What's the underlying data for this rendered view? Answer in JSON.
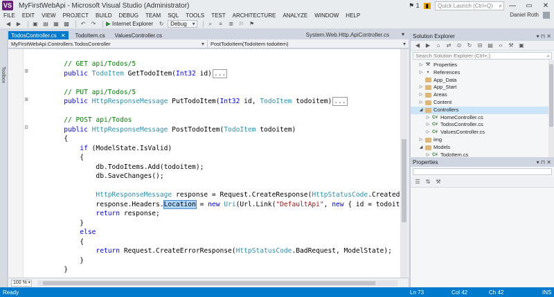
{
  "window": {
    "title": "MyFirstWebApi - Microsoft Visual Studio (Administrator)",
    "logo": "VS",
    "flag_count": "1",
    "notifications": "",
    "quick_launch_placeholder": "Quick Launch (Ctrl+Q)",
    "controls": {
      "minimize": "—",
      "maximize": "▭",
      "close": "✕"
    }
  },
  "menu": {
    "items": [
      "FILE",
      "EDIT",
      "VIEW",
      "PROJECT",
      "BUILD",
      "DEBUG",
      "TEAM",
      "SQL",
      "TOOLS",
      "TEST",
      "ARCHITECTURE",
      "ANALYZE",
      "WINDOW",
      "HELP"
    ],
    "user": "Daniel Roth"
  },
  "toolbar": {
    "run_label": "Internet Explorer",
    "config_label": "Debug"
  },
  "left_rail": {
    "label": "Toolbox"
  },
  "editor_tabs": {
    "tabs": [
      {
        "label": "TodosController.cs",
        "active": true
      },
      {
        "label": "TodoItem.cs",
        "active": false
      },
      {
        "label": "ValuesController.cs",
        "active": false
      }
    ],
    "preview_tab": "System.Web.Http.ApiController.cs"
  },
  "navbar": {
    "type": "MyFirstWebApi.Controllers.TodosController",
    "member": "PostTodoItem(TodoItem todoitem)"
  },
  "code": {
    "lines": [
      [
        {
          "c": "cm",
          "t": "        // GET api/Todos/5"
        }
      ],
      [
        {
          "c": "kw",
          "t": "        public "
        },
        {
          "c": "ty",
          "t": "TodoItem"
        },
        {
          "c": "",
          "t": " GetTodoItem("
        },
        {
          "c": "kw",
          "t": "Int32"
        },
        {
          "c": "",
          "t": " id)"
        },
        {
          "c": "collapsed",
          "t": "..."
        }
      ],
      [],
      [
        {
          "c": "cm",
          "t": "        // PUT api/Todos/5"
        }
      ],
      [
        {
          "c": "kw",
          "t": "        public "
        },
        {
          "c": "ty",
          "t": "HttpResponseMessage"
        },
        {
          "c": "",
          "t": " PutTodoItem("
        },
        {
          "c": "kw",
          "t": "Int32"
        },
        {
          "c": "",
          "t": " id, "
        },
        {
          "c": "ty",
          "t": "TodoItem"
        },
        {
          "c": "",
          "t": " todoitem)"
        },
        {
          "c": "collapsed",
          "t": "..."
        }
      ],
      [],
      [
        {
          "c": "cm",
          "t": "        // POST api/Todos"
        }
      ],
      [
        {
          "c": "kw",
          "t": "        public "
        },
        {
          "c": "ty",
          "t": "HttpResponseMessage"
        },
        {
          "c": "",
          "t": " PostTodoItem("
        },
        {
          "c": "ty",
          "t": "TodoItem"
        },
        {
          "c": "",
          "t": " todoitem)"
        }
      ],
      [
        {
          "c": "",
          "t": "        {"
        }
      ],
      [
        {
          "c": "kw",
          "t": "            if"
        },
        {
          "c": "",
          "t": " (ModelState.IsValid)"
        }
      ],
      [
        {
          "c": "",
          "t": "            {"
        }
      ],
      [
        {
          "c": "",
          "t": "                db.TodoItems.Add(todoitem);"
        }
      ],
      [
        {
          "c": "",
          "t": "                db.SaveChanges();"
        }
      ],
      [],
      [
        {
          "c": "ty",
          "t": "                HttpResponseMessage"
        },
        {
          "c": "",
          "t": " response = Request.CreateResponse("
        },
        {
          "c": "ty",
          "t": "HttpStatusCode"
        },
        {
          "c": "",
          "t": ".Created"
        }
      ],
      [
        {
          "c": "",
          "t": "                response.Headers."
        },
        {
          "c": "sel",
          "t": "Location"
        },
        {
          "c": "",
          "t": " = "
        },
        {
          "c": "kw",
          "t": "new "
        },
        {
          "c": "ty",
          "t": "Uri"
        },
        {
          "c": "",
          "t": "(Url.Link("
        },
        {
          "c": "st",
          "t": "\"DefaultApi\""
        },
        {
          "c": "",
          "t": ", "
        },
        {
          "c": "kw",
          "t": "new"
        },
        {
          "c": "",
          "t": " { id = todoit"
        }
      ],
      [
        {
          "c": "kw",
          "t": "                return"
        },
        {
          "c": "",
          "t": " response;"
        }
      ],
      [
        {
          "c": "",
          "t": "            }"
        }
      ],
      [
        {
          "c": "kw",
          "t": "            else"
        }
      ],
      [
        {
          "c": "",
          "t": "            {"
        }
      ],
      [
        {
          "c": "kw",
          "t": "                return"
        },
        {
          "c": "",
          "t": " Request.CreateErrorResponse("
        },
        {
          "c": "ty",
          "t": "HttpStatusCode"
        },
        {
          "c": "",
          "t": ".BadRequest, ModelState);"
        }
      ],
      [
        {
          "c": "",
          "t": "            }"
        }
      ],
      [
        {
          "c": "",
          "t": "        }"
        }
      ]
    ]
  },
  "editor_bottom": {
    "zoom": "100 %"
  },
  "solution_explorer": {
    "title": "Solution Explorer",
    "search_placeholder": "Search Solution Explorer (Ctrl+;)",
    "items": [
      {
        "label": "Properties",
        "indent": 1,
        "twisty": "▷",
        "icon": "wrench"
      },
      {
        "label": "References",
        "indent": 1,
        "twisty": "▷",
        "icon": "refs"
      },
      {
        "label": "App_Data",
        "indent": 1,
        "twisty": "",
        "icon": "folder"
      },
      {
        "label": "App_Start",
        "indent": 1,
        "twisty": "▷",
        "icon": "folder"
      },
      {
        "label": "Areas",
        "indent": 1,
        "twisty": "▷",
        "icon": "folder"
      },
      {
        "label": "Content",
        "indent": 1,
        "twisty": "▷",
        "icon": "folder"
      },
      {
        "label": "Controllers",
        "indent": 1,
        "twisty": "◢",
        "icon": "folder",
        "selected": true
      },
      {
        "label": "HomeController.cs",
        "indent": 2,
        "twisty": "▷",
        "icon": "cs"
      },
      {
        "label": "TodosController.cs",
        "indent": 2,
        "twisty": "▷",
        "icon": "cs"
      },
      {
        "label": "ValuesController.cs",
        "indent": 2,
        "twisty": "▷",
        "icon": "cs"
      },
      {
        "label": "img",
        "indent": 1,
        "twisty": "▷",
        "icon": "folder"
      },
      {
        "label": "Models",
        "indent": 1,
        "twisty": "◢",
        "icon": "folder"
      },
      {
        "label": "TodoItem.cs",
        "indent": 2,
        "twisty": "▷",
        "icon": "cs"
      }
    ]
  },
  "properties": {
    "title": "Properties"
  },
  "status": {
    "ready": "Ready",
    "line": "Ln 73",
    "col": "Col 42",
    "ch": "Ch 42",
    "mode": "INS"
  },
  "colors": {
    "accent": "#007acc",
    "chrome": "#cfd6e2"
  }
}
